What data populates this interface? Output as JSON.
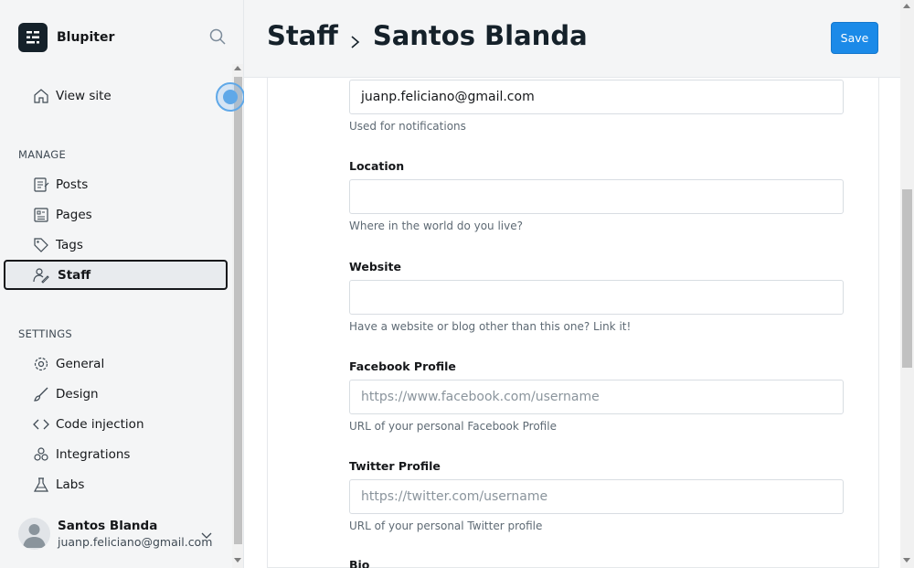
{
  "brand": {
    "name": "Blupiter"
  },
  "sidebar": {
    "view_site": "View site",
    "manage_title": "MANAGE",
    "manage_items": [
      {
        "label": "Posts",
        "icon": "posts-icon"
      },
      {
        "label": "Pages",
        "icon": "pages-icon"
      },
      {
        "label": "Tags",
        "icon": "tag-icon"
      },
      {
        "label": "Staff",
        "icon": "staff-icon",
        "active": true
      }
    ],
    "settings_title": "SETTINGS",
    "settings_items": [
      {
        "label": "General",
        "icon": "gear-icon"
      },
      {
        "label": "Design",
        "icon": "brush-icon"
      },
      {
        "label": "Code injection",
        "icon": "code-icon"
      },
      {
        "label": "Integrations",
        "icon": "integrations-icon"
      },
      {
        "label": "Labs",
        "icon": "flask-icon"
      }
    ],
    "user": {
      "name": "Santos Blanda",
      "email": "juanp.feliciano@gmail.com"
    }
  },
  "header": {
    "crumb_parent": "Staff",
    "crumb_current": "Santos Blanda",
    "save_label": "Save"
  },
  "form": {
    "email": {
      "value": "juanp.feliciano@gmail.com",
      "help": "Used for notifications"
    },
    "location": {
      "label": "Location",
      "value": "",
      "help": "Where in the world do you live?"
    },
    "website": {
      "label": "Website",
      "value": "",
      "help": "Have a website or blog other than this one? Link it!"
    },
    "facebook": {
      "label": "Facebook Profile",
      "placeholder": "https://www.facebook.com/username",
      "help": "URL of your personal Facebook Profile"
    },
    "twitter": {
      "label": "Twitter Profile",
      "placeholder": "https://twitter.com/username",
      "help": "URL of your personal Twitter profile"
    },
    "bio": {
      "label": "Bio"
    }
  },
  "colors": {
    "accent": "#1b8ae8",
    "sidebar_bg": "#f4f5f6"
  }
}
